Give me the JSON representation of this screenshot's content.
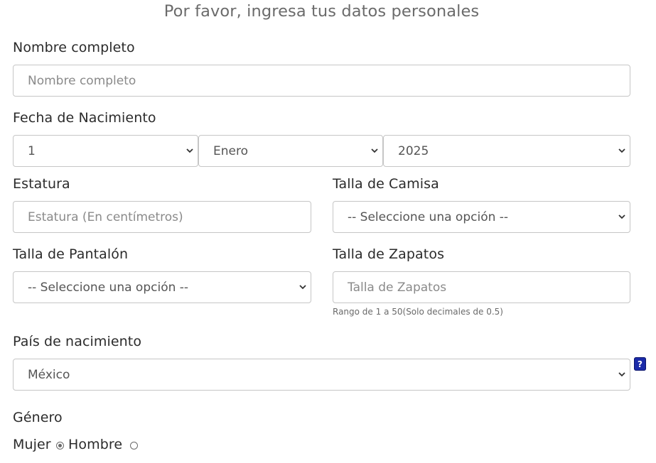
{
  "form": {
    "title": "Por favor, ingresa tus datos personales",
    "full_name": {
      "label": "Nombre completo",
      "placeholder": "Nombre completo"
    },
    "birth_date": {
      "label": "Fecha de Nacimiento",
      "day": "1",
      "month": "Enero",
      "year": "2025"
    },
    "height": {
      "label": "Estatura",
      "placeholder": "Estatura (En centímetros)"
    },
    "shirt_size": {
      "label": "Talla de Camisa",
      "value": "-- Seleccione una opción --"
    },
    "pants_size": {
      "label": "Talla de Pantalón",
      "value": "-- Seleccione una opción --"
    },
    "shoe_size": {
      "label": "Talla de Zapatos",
      "placeholder": "Talla de Zapatos",
      "hint": "Rango de 1 a 50(Solo decimales de 0.5)"
    },
    "birth_country": {
      "label": "País de nacimiento",
      "value": "México",
      "help": "?"
    },
    "gender": {
      "label": "Género",
      "options": [
        {
          "label": "Mujer",
          "checked": true
        },
        {
          "label": "Hombre",
          "checked": false
        }
      ]
    }
  },
  "colors": {
    "help_badge": "#1a2aa8",
    "border": "#c6c6c6",
    "title": "#6b6b6b"
  }
}
